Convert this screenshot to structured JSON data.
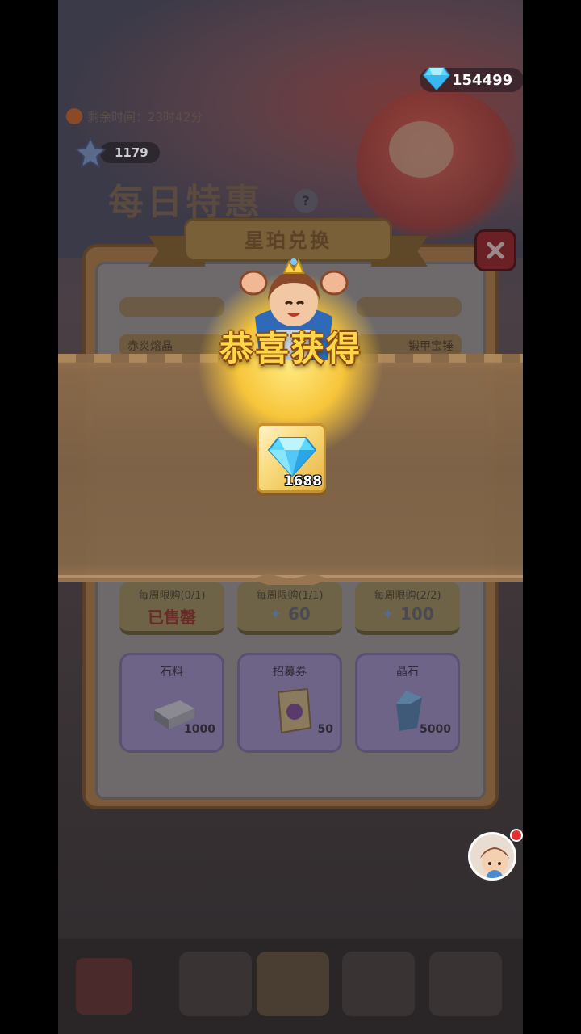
{
  "currency": {
    "gems": "154499"
  },
  "event": {
    "timer_label": "剩余时间：23时42分",
    "stardust": "1179",
    "title": "每日特惠",
    "help": "?"
  },
  "shop": {
    "title": "星珀兑换",
    "top_items": [
      {
        "label": "赤炎熔晶"
      },
      {
        "label": "锻甲宝锤"
      }
    ],
    "row1": [
      {
        "limit": "每周限购(0/1)",
        "price": "已售罄",
        "sold_out": true
      },
      {
        "limit": "每周限购(1/1)",
        "price": "60",
        "currency_icon": "stardust-icon"
      },
      {
        "limit": "每周限购(2/2)",
        "price": "100",
        "currency_icon": "stardust-icon"
      }
    ],
    "row2": [
      {
        "name": "石料",
        "qty": "1000",
        "icon": "stone-icon"
      },
      {
        "name": "招募券",
        "qty": "50",
        "icon": "recruit-ticket-icon"
      },
      {
        "name": "晶石",
        "qty": "5000",
        "icon": "crystal-icon"
      }
    ]
  },
  "reward": {
    "title": "恭喜获得",
    "item": {
      "icon": "diamond-icon",
      "count": "1688"
    }
  },
  "colors": {
    "gold": "#ffd748",
    "diamond": "#5ad8ff",
    "close_red": "#e03a40"
  }
}
